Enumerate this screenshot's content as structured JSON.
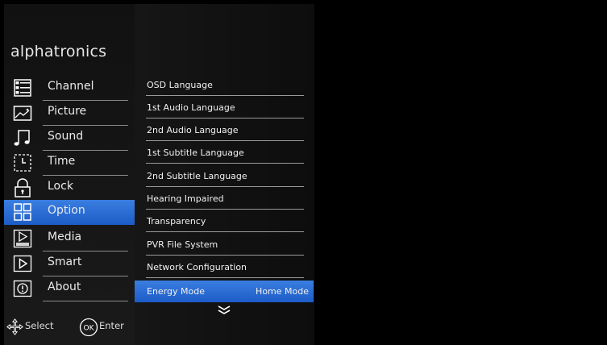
{
  "brand": "alphatronics",
  "menu": [
    {
      "label": "Channel",
      "icon": "channel-list-icon"
    },
    {
      "label": "Picture",
      "icon": "picture-icon"
    },
    {
      "label": "Sound",
      "icon": "music-note-icon"
    },
    {
      "label": "Time",
      "icon": "clock-icon"
    },
    {
      "label": "Lock",
      "icon": "lock-icon"
    },
    {
      "label": "Option",
      "icon": "grid-icon",
      "active": true
    },
    {
      "label": "Media",
      "icon": "media-play-icon"
    },
    {
      "label": "Smart",
      "icon": "smart-play-icon"
    },
    {
      "label": "About",
      "icon": "info-icon"
    }
  ],
  "options": [
    {
      "label": "OSD Language"
    },
    {
      "label": "1st Audio Language"
    },
    {
      "label": "2nd Audio Language"
    },
    {
      "label": "1st Subtitle Language"
    },
    {
      "label": "2nd Subtitle Language"
    },
    {
      "label": "Hearing Impaired"
    },
    {
      "label": "Transparency"
    },
    {
      "label": "PVR File System"
    },
    {
      "label": "Network Configuration"
    },
    {
      "label": "Energy Mode",
      "value": "Home Mode",
      "active": true
    }
  ],
  "footer": {
    "select_label": "Select",
    "ok_icon_text": "OK",
    "enter_label": "Enter"
  },
  "icons": {
    "more": "double-chevron-down-icon"
  },
  "colors": {
    "highlight": "#2a6ed6",
    "background": "#000000"
  }
}
